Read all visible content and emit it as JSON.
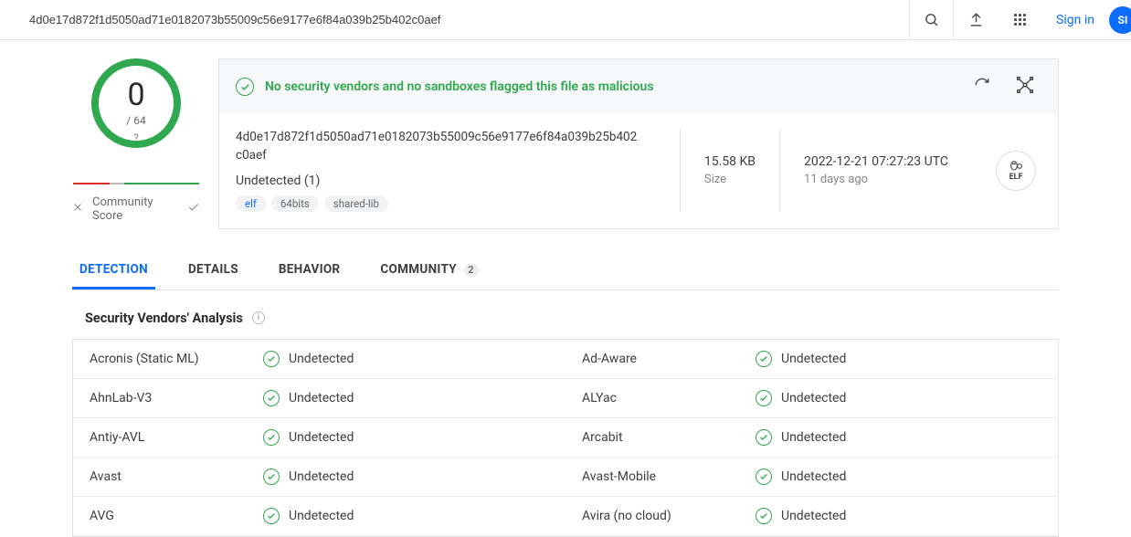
{
  "topbar": {
    "search_value": "4d0e17d872f1d5050ad71e0182073b55009c56e9177e6f84a039b25b402c0aef",
    "signin": "Sign in",
    "avatar_initials": "SI"
  },
  "score": {
    "num": "0",
    "denom": "/ 64",
    "question": "?",
    "community_label": "Community Score"
  },
  "banner": {
    "message": "No security vendors and no sandboxes flagged this file as malicious"
  },
  "file": {
    "hash": "4d0e17d872f1d5050ad71e0182073b55009c56e9177e6f84a039b25b402c0aef",
    "name": "Undetected (1)",
    "tags": {
      "t0": "elf",
      "t1": "64bits",
      "t2": "shared-lib"
    },
    "size_val": "15.58 KB",
    "size_label": "Size",
    "date_val": "2022-12-21 07:27:23 UTC",
    "date_rel": "11 days ago",
    "type_label": "ELF"
  },
  "tabs": {
    "detection": "DETECTION",
    "details": "DETAILS",
    "behavior": "BEHAVIOR",
    "community": "COMMUNITY",
    "community_count": "2"
  },
  "section": {
    "title": "Security Vendors' Analysis"
  },
  "verdict_label": "Undetected",
  "vendors": [
    {
      "left": "Acronis (Static ML)",
      "right": "Ad-Aware"
    },
    {
      "left": "AhnLab-V3",
      "right": "ALYac"
    },
    {
      "left": "Antiy-AVL",
      "right": "Arcabit"
    },
    {
      "left": "Avast",
      "right": "Avast-Mobile"
    },
    {
      "left": "AVG",
      "right": "Avira (no cloud)"
    }
  ]
}
